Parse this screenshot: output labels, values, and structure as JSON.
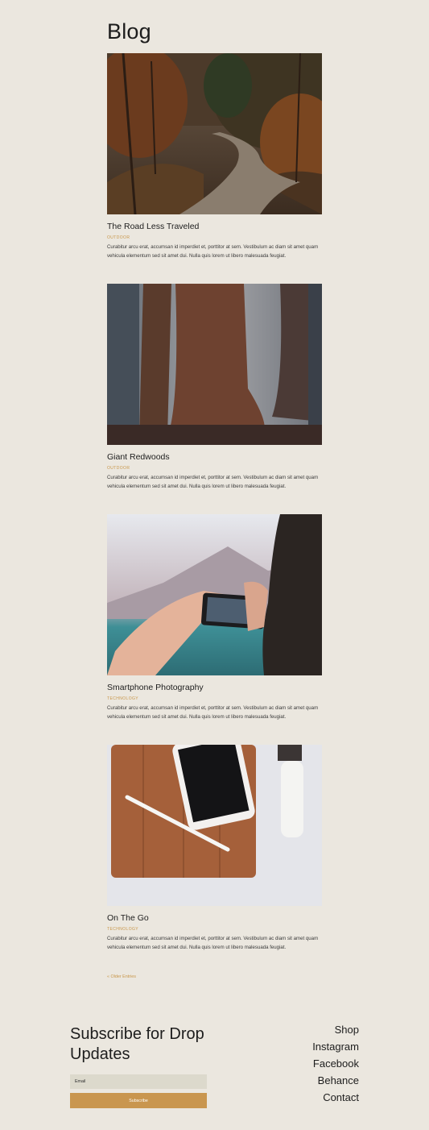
{
  "blog": {
    "title": "Blog",
    "posts": [
      {
        "title": "The Road Less Traveled",
        "category": "OUTDOOR",
        "excerpt": "Curabitur arcu erat, accumsan id imperdiet et, porttitor at sem. Vestibulum ac diam sit amet quam vehicula elementum sed sit amet dui. Nulla quis lorem ut libero malesuada feugiat.",
        "image": "forest-road-photo"
      },
      {
        "title": "Giant Redwoods",
        "category": "OUTDOOR",
        "excerpt": "Curabitur arcu erat, accumsan id imperdiet et, porttitor at sem. Vestibulum ac diam sit amet quam vehicula elementum sed sit amet dui. Nulla quis lorem ut libero malesuada feugiat.",
        "image": "redwood-trees-photo"
      },
      {
        "title": "Smartphone Photography",
        "category": "TECHNOLOGY",
        "excerpt": "Curabitur arcu erat, accumsan id imperdiet et, porttitor at sem. Vestibulum ac diam sit amet quam vehicula elementum sed sit amet dui. Nulla quis lorem ut libero malesuada feugiat.",
        "image": "phone-photography-photo"
      },
      {
        "title": "On The Go",
        "category": "TECHNOLOGY",
        "excerpt": "Curabitur arcu erat, accumsan id imperdiet et, porttitor at sem. Vestibulum ac diam sit amet quam vehicula elementum sed sit amet dui. Nulla quis lorem ut libero malesuada feugiat.",
        "image": "tablet-phone-watch-photo"
      }
    ],
    "older_entries": "« Older Entries"
  },
  "footer": {
    "subscribe_title": "Subscribe for Drop Updates",
    "email_placeholder": "Email",
    "subscribe_label": "Subscribe",
    "links": [
      "Shop",
      "Instagram",
      "Facebook",
      "Behance",
      "Contact"
    ]
  },
  "colors": {
    "background": "#ebe7df",
    "accent": "#c9964f",
    "input_background": "#dcd9cc"
  }
}
